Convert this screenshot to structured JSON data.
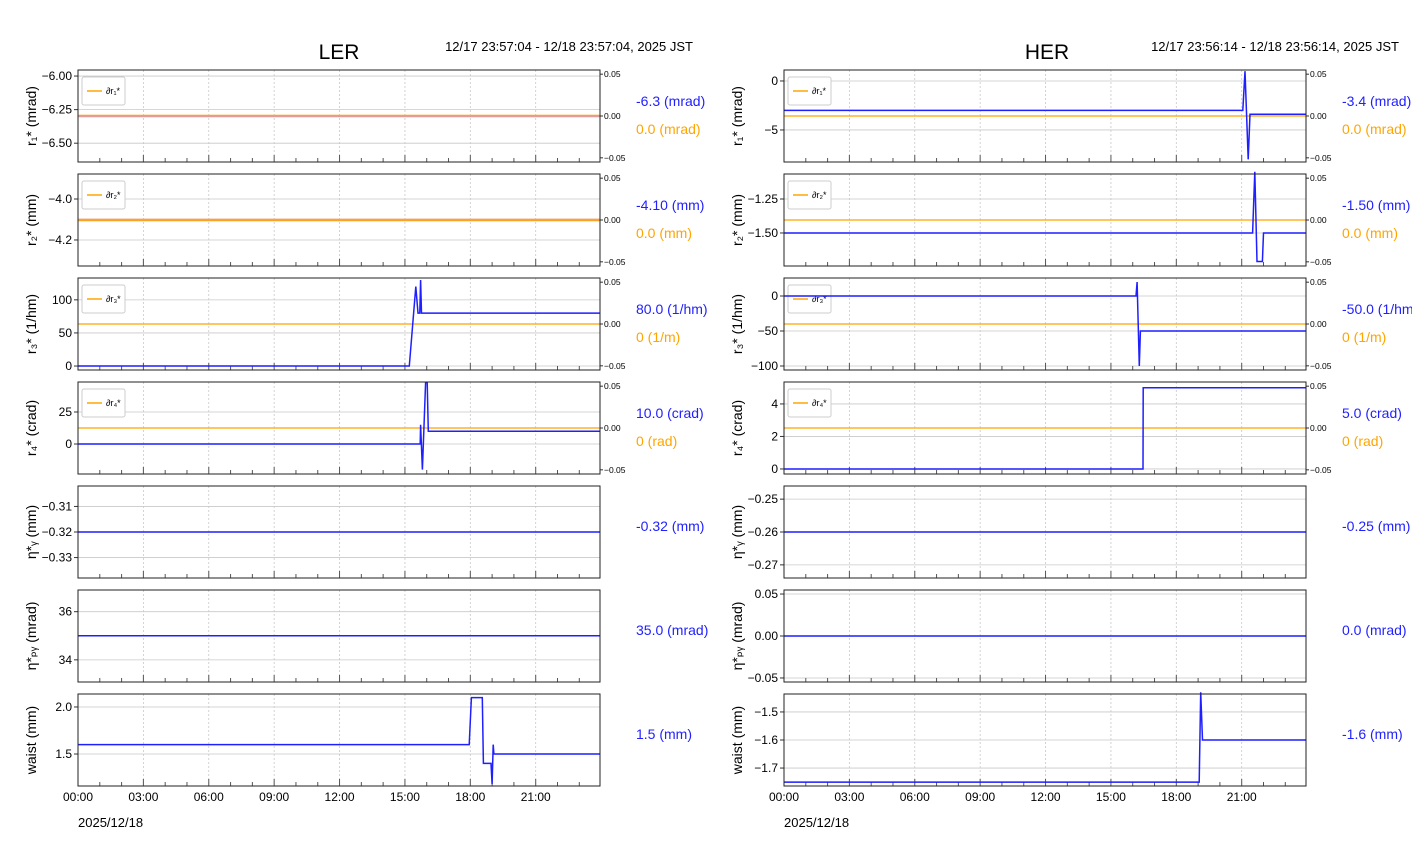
{
  "colors": {
    "signal": "#1f1fff",
    "correction": "#ffa500",
    "grid": "#c8c8c8",
    "frame": "#222222"
  },
  "chart_data": [
    {
      "type": "line",
      "title": "LER",
      "time_range": "12/17 23:57:04 - 12/18 23:57:04, 2025 JST",
      "x_date": "2025/12/18",
      "xlim": [
        0,
        23.95
      ],
      "xtick_labels": [
        "00:00",
        "03:00",
        "06:00",
        "09:00",
        "12:00",
        "15:00",
        "18:00",
        "21:00"
      ],
      "panels": [
        {
          "ylabel": "r₁* (mrad)",
          "ylim": [
            -6.64,
            -5.955
          ],
          "yticks": [
            -6.0,
            -6.25,
            -6.5
          ],
          "ytick_labels": [
            "−6.00",
            "−6.25",
            "−6.50"
          ],
          "points": [
            [
              0,
              -6.3
            ],
            [
              23.95,
              -6.3
            ]
          ],
          "overlap": true,
          "correction": {
            "legend": "∂r₁*",
            "right_ylim": [
              -0.055,
              0.055
            ],
            "right_ticks": [
              "0.05",
              "0.00",
              "−0.05"
            ],
            "value": 0
          },
          "readout": "-6.3 (mrad)",
          "readout2": "0.0 (mrad)"
        },
        {
          "ylabel": "r₂* (mm)",
          "ylim": [
            -4.327,
            -3.878
          ],
          "yticks": [
            -4.0,
            -4.2
          ],
          "ytick_labels": [
            "−4.0",
            "−4.2"
          ],
          "points": [
            [
              0,
              -4.1
            ],
            [
              23.95,
              -4.1
            ]
          ],
          "overlap": true,
          "correction": {
            "legend": "∂r₂*",
            "right_ylim": [
              -0.055,
              0.055
            ],
            "right_ticks": [
              "0.05",
              "0.00",
              "−0.05"
            ],
            "value": 0
          },
          "readout": "-4.10 (mm)",
          "readout2": "0.0 (mm)"
        },
        {
          "ylabel": "r₃* (1/hm)",
          "ylim": [
            -6,
            133
          ],
          "yticks": [
            100,
            50,
            0
          ],
          "ytick_labels": [
            "100",
            "50",
            "0"
          ],
          "points": [
            [
              0,
              0
            ],
            [
              15.2,
              0
            ],
            [
              15.5,
              120
            ],
            [
              15.6,
              80
            ],
            [
              15.68,
              80
            ],
            [
              15.72,
              130
            ],
            [
              15.76,
              80
            ],
            [
              23.95,
              80
            ]
          ],
          "correction": {
            "legend": "∂r₃*",
            "right_ylim": [
              -0.055,
              0.055
            ],
            "right_ticks": [
              "0.05",
              "0.00",
              "−0.05"
            ],
            "value": 0
          },
          "readout": "80.0 (1/hm)",
          "readout2": "0 (1/m)"
        },
        {
          "ylabel": "r₄* (crad)",
          "ylim": [
            -23.4,
            48.4
          ],
          "yticks": [
            25,
            0
          ],
          "ytick_labels": [
            "25",
            "0"
          ],
          "points": [
            [
              0,
              0
            ],
            [
              15.7,
              0
            ],
            [
              15.72,
              15
            ],
            [
              15.8,
              -20
            ],
            [
              15.95,
              48
            ],
            [
              16.02,
              48
            ],
            [
              16.07,
              10
            ],
            [
              23.95,
              10
            ]
          ],
          "correction": {
            "legend": "∂r₄*",
            "right_ylim": [
              -0.055,
              0.055
            ],
            "right_ticks": [
              "0.05",
              "0.00",
              "−0.05"
            ],
            "value": 0
          },
          "readout": "10.0 (crad)",
          "readout2": "0 (rad)"
        },
        {
          "ylabel": "η*ᵧ (mm)",
          "ylim": [
            -0.338,
            -0.302
          ],
          "yticks": [
            -0.31,
            -0.32,
            -0.33
          ],
          "ytick_labels": [
            "−0.31",
            "−0.32",
            "−0.33"
          ],
          "points": [
            [
              0,
              -0.32
            ],
            [
              23.95,
              -0.32
            ]
          ],
          "readout": "-0.32 (mm)"
        },
        {
          "ylabel": "η*ₚᵧ (mrad)",
          "ylim": [
            33.08,
            36.9
          ],
          "yticks": [
            36,
            34
          ],
          "ytick_labels": [
            "36",
            "34"
          ],
          "points": [
            [
              0,
              35
            ],
            [
              23.95,
              35
            ]
          ],
          "readout": "35.0 (mrad)"
        },
        {
          "ylabel": "waist (mm)",
          "ylim": [
            1.16,
            2.138
          ],
          "yticks": [
            2.0,
            1.5
          ],
          "ytick_labels": [
            "2.0",
            "1.5"
          ],
          "points": [
            [
              0,
              1.6
            ],
            [
              17.95,
              1.6
            ],
            [
              18.05,
              2.1
            ],
            [
              18.55,
              2.1
            ],
            [
              18.6,
              1.4
            ],
            [
              18.95,
              1.4
            ],
            [
              19.0,
              1.18
            ],
            [
              19.05,
              1.6
            ],
            [
              19.08,
              1.5
            ],
            [
              23.95,
              1.5
            ]
          ],
          "readout": "1.5 (mm)"
        }
      ]
    },
    {
      "type": "line",
      "title": "HER",
      "time_range": "12/17 23:56:14 - 12/18 23:56:14, 2025 JST",
      "x_date": "2025/12/18",
      "xlim": [
        0,
        23.95
      ],
      "xtick_labels": [
        "00:00",
        "03:00",
        "06:00",
        "09:00",
        "12:00",
        "15:00",
        "18:00",
        "21:00"
      ],
      "panels": [
        {
          "ylabel": "r₁* (mrad)",
          "ylim": [
            -8.27,
            1.12
          ],
          "yticks": [
            0,
            -5
          ],
          "ytick_labels": [
            "0",
            "−5"
          ],
          "points": [
            [
              0,
              -3
            ],
            [
              21.05,
              -3
            ],
            [
              21.15,
              1
            ],
            [
              21.3,
              -8
            ],
            [
              21.38,
              -3.4
            ],
            [
              23.95,
              -3.4
            ]
          ],
          "correction": {
            "legend": "∂r₁*",
            "right_ylim": [
              -0.055,
              0.055
            ],
            "right_ticks": [
              "0.05",
              "0.00",
              "−0.05"
            ],
            "value": 0
          },
          "readout": "-3.4 (mrad)",
          "readout2": "0.0 (mrad)"
        },
        {
          "ylabel": "r₂* (mm)",
          "ylim": [
            -1.743,
            -1.066
          ],
          "yticks": [
            -1.25,
            -1.5
          ],
          "ytick_labels": [
            "−1.25",
            "−1.50"
          ],
          "points": [
            [
              0,
              -1.5
            ],
            [
              21.5,
              -1.5
            ],
            [
              21.6,
              -1.05
            ],
            [
              21.7,
              -1.71
            ],
            [
              21.95,
              -1.71
            ],
            [
              22.0,
              -1.5
            ],
            [
              23.95,
              -1.5
            ]
          ],
          "correction": {
            "legend": "∂r₂*",
            "right_ylim": [
              -0.055,
              0.055
            ],
            "right_ticks": [
              "0.05",
              "0.00",
              "−0.05"
            ],
            "value": 0
          },
          "readout": "-1.50 (mm)",
          "readout2": "0.0 (mm)"
        },
        {
          "ylabel": "r₃* (1/hm)",
          "ylim": [
            -105.7,
            25.7
          ],
          "yticks": [
            0,
            -50,
            -100
          ],
          "ytick_labels": [
            "0",
            "−50",
            "−100"
          ],
          "points": [
            [
              0,
              0
            ],
            [
              16.15,
              0
            ],
            [
              16.2,
              20
            ],
            [
              16.3,
              -100
            ],
            [
              16.35,
              -50
            ],
            [
              23.95,
              -50
            ]
          ],
          "correction": {
            "legend": "∂r₃*",
            "right_ylim": [
              -0.055,
              0.055
            ],
            "right_ticks": [
              "0.05",
              "0.00",
              "−0.05"
            ],
            "value": 0
          },
          "readout": "-50.0 (1/hm)",
          "readout2": "0 (1/m)"
        },
        {
          "ylabel": "r₄* (crad)",
          "ylim": [
            -0.31,
            5.35
          ],
          "yticks": [
            4,
            2,
            0
          ],
          "ytick_labels": [
            "4",
            "2",
            "0"
          ],
          "points": [
            [
              0,
              0
            ],
            [
              16.47,
              0
            ],
            [
              16.48,
              5
            ],
            [
              23.95,
              5
            ]
          ],
          "correction": {
            "legend": "∂r₄*",
            "right_ylim": [
              -0.055,
              0.055
            ],
            "right_ticks": [
              "0.05",
              "0.00",
              "−0.05"
            ],
            "value": 0
          },
          "readout": "5.0 (crad)",
          "readout2": "0 (rad)"
        },
        {
          "ylabel": "η*ᵧ (mm)",
          "ylim": [
            -0.274,
            -0.246
          ],
          "yticks": [
            -0.25,
            -0.26,
            -0.27
          ],
          "ytick_labels": [
            "−0.25",
            "−0.26",
            "−0.27"
          ],
          "points": [
            [
              0,
              -0.26
            ],
            [
              23.95,
              -0.26
            ]
          ],
          "readout": "-0.25 (mm)"
        },
        {
          "ylabel": "η*ₚᵧ (mrad)",
          "ylim": [
            -0.0548,
            0.0548
          ],
          "yticks": [
            0.05,
            0,
            -0.05
          ],
          "ytick_labels": [
            "0.05",
            "0.00",
            "−0.05"
          ],
          "points": [
            [
              0,
              0
            ],
            [
              23.95,
              0
            ]
          ],
          "readout": "0.0 (mrad)"
        },
        {
          "ylabel": "waist (mm)",
          "ylim": [
            -1.764,
            -1.436
          ],
          "yticks": [
            -1.5,
            -1.6,
            -1.7
          ],
          "ytick_labels": [
            "−1.5",
            "−1.6",
            "−1.7"
          ],
          "points": [
            [
              0,
              -1.75
            ],
            [
              19.05,
              -1.75
            ],
            [
              19.12,
              -1.43
            ],
            [
              19.2,
              -1.6
            ],
            [
              23.95,
              -1.6
            ]
          ],
          "readout": "-1.6 (mm)"
        }
      ]
    }
  ]
}
